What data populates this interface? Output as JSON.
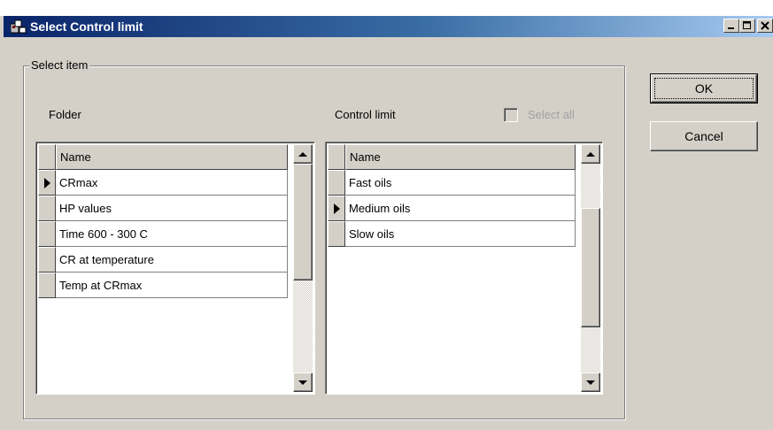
{
  "window": {
    "title": "Select Control limit",
    "controls": {
      "minimize": "_",
      "maximize": "□",
      "close": "X"
    }
  },
  "group": {
    "legend": "Select item"
  },
  "folder": {
    "label": "Folder",
    "column_header": "Name",
    "selected_index": 0,
    "rows": [
      "CRmax",
      "HP values",
      "Time 600 - 300 C",
      "CR at temperature",
      "Temp at CRmax"
    ]
  },
  "control_limit": {
    "label": "Control limit",
    "select_all_label": "Select all",
    "select_all_checked": false,
    "select_all_enabled": false,
    "column_header": "Name",
    "selected_index": 1,
    "rows": [
      "Fast oils",
      "Medium oils",
      "Slow oils"
    ]
  },
  "buttons": {
    "ok": "OK",
    "cancel": "Cancel"
  }
}
